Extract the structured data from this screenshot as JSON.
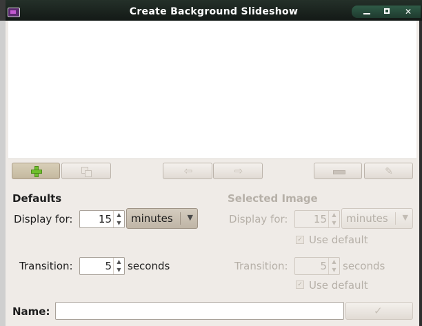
{
  "window": {
    "title": "Create Background Slideshow",
    "accent": "#2f5b47"
  },
  "toolbar": {
    "add_icon": "plus-icon",
    "duplicate_icon": "duplicate-icon",
    "move_left_icon": "arrow-left-icon",
    "move_right_icon": "arrow-right-icon",
    "remove_icon": "minus-icon",
    "clear_icon": "broom-icon"
  },
  "defaults": {
    "heading": "Defaults",
    "display_for_label": "Display for:",
    "display_for_value": "15",
    "display_unit": "minutes",
    "transition_label": "Transition:",
    "transition_value": "5",
    "transition_unit": "seconds"
  },
  "selected_image": {
    "heading": "Selected Image",
    "display_for_label": "Display for:",
    "display_for_value": "15",
    "display_unit": "minutes",
    "use_default_1": "Use default",
    "transition_label": "Transition:",
    "transition_value": "5",
    "transition_unit": "seconds",
    "use_default_2": "Use default"
  },
  "name": {
    "label": "Name:",
    "value": ""
  }
}
